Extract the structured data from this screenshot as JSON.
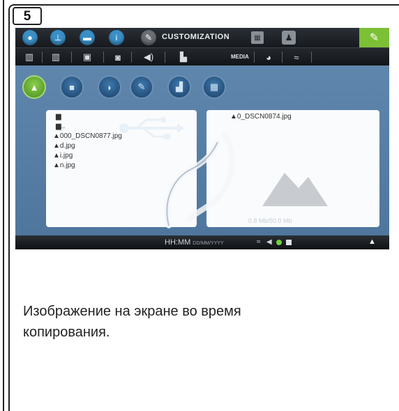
{
  "step_number": "5",
  "screen": {
    "top_bar": {
      "icons": [
        "drop-icon",
        "level-icon",
        "tray-icon",
        "info-icon",
        "brush-icon",
        "calendar-icon",
        "user-icon"
      ],
      "active_label": "CUSTOMIZATION",
      "settings_icon": "wrench-icon"
    },
    "second_bar": {
      "icons": [
        "book-icon",
        "book-open-icon",
        "picture-icon",
        "disk-icon",
        "speaker-icon",
        "media-folder-icon",
        "palette-icon",
        "wifi-icon"
      ],
      "media_label": "MEDIA"
    },
    "media_tabs": [
      "picture-tab",
      "video-tab",
      "audio-tab",
      "document-tab",
      "slideshow-tab",
      "other-tab"
    ],
    "left_pane": {
      "items": [
        {
          "icon": "folder",
          "name": ""
        },
        {
          "icon": "folder",
          "name": ".."
        },
        {
          "icon": "image",
          "name": "000_DSCN0877.jpg"
        },
        {
          "icon": "image",
          "name": "d.jpg"
        },
        {
          "icon": "image",
          "name": "i.jpg"
        },
        {
          "icon": "image",
          "name": "n.jpg"
        }
      ]
    },
    "right_pane": {
      "items": [
        {
          "icon": "image",
          "name": "0_DSCN0874.jpg"
        }
      ],
      "storage": "0.8 Mb/50.0 Mb"
    },
    "status_bar": {
      "time": "HH:MM",
      "date": "DD/MM/YYYY"
    }
  },
  "caption": "Изображение на экране во время копирования."
}
